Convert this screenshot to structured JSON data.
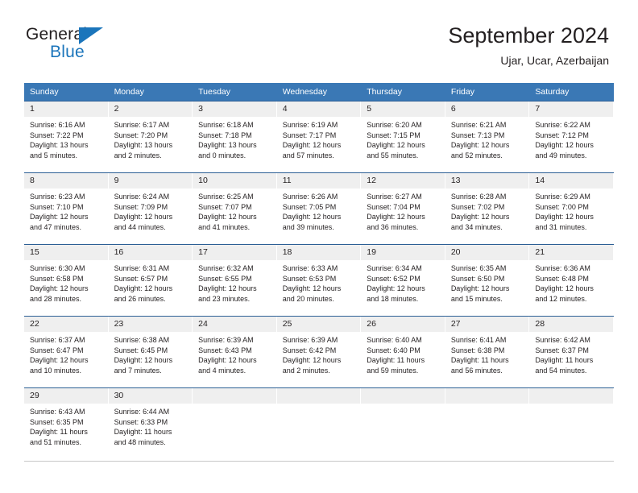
{
  "brand": {
    "name_part1": "General",
    "name_part2": "Blue",
    "triangle_color": "#1b75bb"
  },
  "header": {
    "title": "September 2024",
    "subtitle": "Ujar, Ucar, Azerbaijan",
    "header_bg_color": "#3a78b5",
    "row_border_color": "#2c5f95",
    "daynum_bg_color": "#efefef"
  },
  "weekday_headers": [
    "Sunday",
    "Monday",
    "Tuesday",
    "Wednesday",
    "Thursday",
    "Friday",
    "Saturday"
  ],
  "labels": {
    "sunrise_prefix": "Sunrise:",
    "sunset_prefix": "Sunset:",
    "daylight_prefix": "Daylight:"
  },
  "weeks": [
    [
      {
        "day": "1",
        "sunrise": "Sunrise: 6:16 AM",
        "sunset": "Sunset: 7:22 PM",
        "daylight_line1": "Daylight: 13 hours",
        "daylight_line2": "and 5 minutes."
      },
      {
        "day": "2",
        "sunrise": "Sunrise: 6:17 AM",
        "sunset": "Sunset: 7:20 PM",
        "daylight_line1": "Daylight: 13 hours",
        "daylight_line2": "and 2 minutes."
      },
      {
        "day": "3",
        "sunrise": "Sunrise: 6:18 AM",
        "sunset": "Sunset: 7:18 PM",
        "daylight_line1": "Daylight: 13 hours",
        "daylight_line2": "and 0 minutes."
      },
      {
        "day": "4",
        "sunrise": "Sunrise: 6:19 AM",
        "sunset": "Sunset: 7:17 PM",
        "daylight_line1": "Daylight: 12 hours",
        "daylight_line2": "and 57 minutes."
      },
      {
        "day": "5",
        "sunrise": "Sunrise: 6:20 AM",
        "sunset": "Sunset: 7:15 PM",
        "daylight_line1": "Daylight: 12 hours",
        "daylight_line2": "and 55 minutes."
      },
      {
        "day": "6",
        "sunrise": "Sunrise: 6:21 AM",
        "sunset": "Sunset: 7:13 PM",
        "daylight_line1": "Daylight: 12 hours",
        "daylight_line2": "and 52 minutes."
      },
      {
        "day": "7",
        "sunrise": "Sunrise: 6:22 AM",
        "sunset": "Sunset: 7:12 PM",
        "daylight_line1": "Daylight: 12 hours",
        "daylight_line2": "and 49 minutes."
      }
    ],
    [
      {
        "day": "8",
        "sunrise": "Sunrise: 6:23 AM",
        "sunset": "Sunset: 7:10 PM",
        "daylight_line1": "Daylight: 12 hours",
        "daylight_line2": "and 47 minutes."
      },
      {
        "day": "9",
        "sunrise": "Sunrise: 6:24 AM",
        "sunset": "Sunset: 7:09 PM",
        "daylight_line1": "Daylight: 12 hours",
        "daylight_line2": "and 44 minutes."
      },
      {
        "day": "10",
        "sunrise": "Sunrise: 6:25 AM",
        "sunset": "Sunset: 7:07 PM",
        "daylight_line1": "Daylight: 12 hours",
        "daylight_line2": "and 41 minutes."
      },
      {
        "day": "11",
        "sunrise": "Sunrise: 6:26 AM",
        "sunset": "Sunset: 7:05 PM",
        "daylight_line1": "Daylight: 12 hours",
        "daylight_line2": "and 39 minutes."
      },
      {
        "day": "12",
        "sunrise": "Sunrise: 6:27 AM",
        "sunset": "Sunset: 7:04 PM",
        "daylight_line1": "Daylight: 12 hours",
        "daylight_line2": "and 36 minutes."
      },
      {
        "day": "13",
        "sunrise": "Sunrise: 6:28 AM",
        "sunset": "Sunset: 7:02 PM",
        "daylight_line1": "Daylight: 12 hours",
        "daylight_line2": "and 34 minutes."
      },
      {
        "day": "14",
        "sunrise": "Sunrise: 6:29 AM",
        "sunset": "Sunset: 7:00 PM",
        "daylight_line1": "Daylight: 12 hours",
        "daylight_line2": "and 31 minutes."
      }
    ],
    [
      {
        "day": "15",
        "sunrise": "Sunrise: 6:30 AM",
        "sunset": "Sunset: 6:58 PM",
        "daylight_line1": "Daylight: 12 hours",
        "daylight_line2": "and 28 minutes."
      },
      {
        "day": "16",
        "sunrise": "Sunrise: 6:31 AM",
        "sunset": "Sunset: 6:57 PM",
        "daylight_line1": "Daylight: 12 hours",
        "daylight_line2": "and 26 minutes."
      },
      {
        "day": "17",
        "sunrise": "Sunrise: 6:32 AM",
        "sunset": "Sunset: 6:55 PM",
        "daylight_line1": "Daylight: 12 hours",
        "daylight_line2": "and 23 minutes."
      },
      {
        "day": "18",
        "sunrise": "Sunrise: 6:33 AM",
        "sunset": "Sunset: 6:53 PM",
        "daylight_line1": "Daylight: 12 hours",
        "daylight_line2": "and 20 minutes."
      },
      {
        "day": "19",
        "sunrise": "Sunrise: 6:34 AM",
        "sunset": "Sunset: 6:52 PM",
        "daylight_line1": "Daylight: 12 hours",
        "daylight_line2": "and 18 minutes."
      },
      {
        "day": "20",
        "sunrise": "Sunrise: 6:35 AM",
        "sunset": "Sunset: 6:50 PM",
        "daylight_line1": "Daylight: 12 hours",
        "daylight_line2": "and 15 minutes."
      },
      {
        "day": "21",
        "sunrise": "Sunrise: 6:36 AM",
        "sunset": "Sunset: 6:48 PM",
        "daylight_line1": "Daylight: 12 hours",
        "daylight_line2": "and 12 minutes."
      }
    ],
    [
      {
        "day": "22",
        "sunrise": "Sunrise: 6:37 AM",
        "sunset": "Sunset: 6:47 PM",
        "daylight_line1": "Daylight: 12 hours",
        "daylight_line2": "and 10 minutes."
      },
      {
        "day": "23",
        "sunrise": "Sunrise: 6:38 AM",
        "sunset": "Sunset: 6:45 PM",
        "daylight_line1": "Daylight: 12 hours",
        "daylight_line2": "and 7 minutes."
      },
      {
        "day": "24",
        "sunrise": "Sunrise: 6:39 AM",
        "sunset": "Sunset: 6:43 PM",
        "daylight_line1": "Daylight: 12 hours",
        "daylight_line2": "and 4 minutes."
      },
      {
        "day": "25",
        "sunrise": "Sunrise: 6:39 AM",
        "sunset": "Sunset: 6:42 PM",
        "daylight_line1": "Daylight: 12 hours",
        "daylight_line2": "and 2 minutes."
      },
      {
        "day": "26",
        "sunrise": "Sunrise: 6:40 AM",
        "sunset": "Sunset: 6:40 PM",
        "daylight_line1": "Daylight: 11 hours",
        "daylight_line2": "and 59 minutes."
      },
      {
        "day": "27",
        "sunrise": "Sunrise: 6:41 AM",
        "sunset": "Sunset: 6:38 PM",
        "daylight_line1": "Daylight: 11 hours",
        "daylight_line2": "and 56 minutes."
      },
      {
        "day": "28",
        "sunrise": "Sunrise: 6:42 AM",
        "sunset": "Sunset: 6:37 PM",
        "daylight_line1": "Daylight: 11 hours",
        "daylight_line2": "and 54 minutes."
      }
    ],
    [
      {
        "day": "29",
        "sunrise": "Sunrise: 6:43 AM",
        "sunset": "Sunset: 6:35 PM",
        "daylight_line1": "Daylight: 11 hours",
        "daylight_line2": "and 51 minutes."
      },
      {
        "day": "30",
        "sunrise": "Sunrise: 6:44 AM",
        "sunset": "Sunset: 6:33 PM",
        "daylight_line1": "Daylight: 11 hours",
        "daylight_line2": "and 48 minutes."
      },
      {
        "day": "",
        "sunrise": "",
        "sunset": "",
        "daylight_line1": "",
        "daylight_line2": ""
      },
      {
        "day": "",
        "sunrise": "",
        "sunset": "",
        "daylight_line1": "",
        "daylight_line2": ""
      },
      {
        "day": "",
        "sunrise": "",
        "sunset": "",
        "daylight_line1": "",
        "daylight_line2": ""
      },
      {
        "day": "",
        "sunrise": "",
        "sunset": "",
        "daylight_line1": "",
        "daylight_line2": ""
      },
      {
        "day": "",
        "sunrise": "",
        "sunset": "",
        "daylight_line1": "",
        "daylight_line2": ""
      }
    ]
  ]
}
